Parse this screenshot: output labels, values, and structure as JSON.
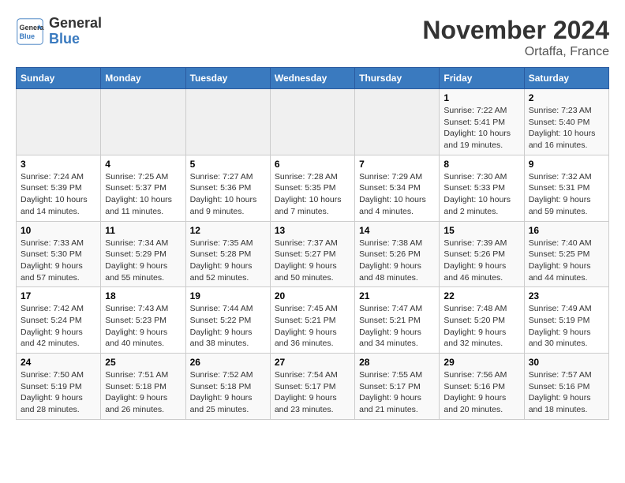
{
  "logo": {
    "line1": "General",
    "line2": "Blue"
  },
  "title": "November 2024",
  "location": "Ortaffa, France",
  "weekdays": [
    "Sunday",
    "Monday",
    "Tuesday",
    "Wednesday",
    "Thursday",
    "Friday",
    "Saturday"
  ],
  "weeks": [
    [
      {
        "day": "",
        "info": ""
      },
      {
        "day": "",
        "info": ""
      },
      {
        "day": "",
        "info": ""
      },
      {
        "day": "",
        "info": ""
      },
      {
        "day": "",
        "info": ""
      },
      {
        "day": "1",
        "info": "Sunrise: 7:22 AM\nSunset: 5:41 PM\nDaylight: 10 hours and 19 minutes."
      },
      {
        "day": "2",
        "info": "Sunrise: 7:23 AM\nSunset: 5:40 PM\nDaylight: 10 hours and 16 minutes."
      }
    ],
    [
      {
        "day": "3",
        "info": "Sunrise: 7:24 AM\nSunset: 5:39 PM\nDaylight: 10 hours and 14 minutes."
      },
      {
        "day": "4",
        "info": "Sunrise: 7:25 AM\nSunset: 5:37 PM\nDaylight: 10 hours and 11 minutes."
      },
      {
        "day": "5",
        "info": "Sunrise: 7:27 AM\nSunset: 5:36 PM\nDaylight: 10 hours and 9 minutes."
      },
      {
        "day": "6",
        "info": "Sunrise: 7:28 AM\nSunset: 5:35 PM\nDaylight: 10 hours and 7 minutes."
      },
      {
        "day": "7",
        "info": "Sunrise: 7:29 AM\nSunset: 5:34 PM\nDaylight: 10 hours and 4 minutes."
      },
      {
        "day": "8",
        "info": "Sunrise: 7:30 AM\nSunset: 5:33 PM\nDaylight: 10 hours and 2 minutes."
      },
      {
        "day": "9",
        "info": "Sunrise: 7:32 AM\nSunset: 5:31 PM\nDaylight: 9 hours and 59 minutes."
      }
    ],
    [
      {
        "day": "10",
        "info": "Sunrise: 7:33 AM\nSunset: 5:30 PM\nDaylight: 9 hours and 57 minutes."
      },
      {
        "day": "11",
        "info": "Sunrise: 7:34 AM\nSunset: 5:29 PM\nDaylight: 9 hours and 55 minutes."
      },
      {
        "day": "12",
        "info": "Sunrise: 7:35 AM\nSunset: 5:28 PM\nDaylight: 9 hours and 52 minutes."
      },
      {
        "day": "13",
        "info": "Sunrise: 7:37 AM\nSunset: 5:27 PM\nDaylight: 9 hours and 50 minutes."
      },
      {
        "day": "14",
        "info": "Sunrise: 7:38 AM\nSunset: 5:26 PM\nDaylight: 9 hours and 48 minutes."
      },
      {
        "day": "15",
        "info": "Sunrise: 7:39 AM\nSunset: 5:26 PM\nDaylight: 9 hours and 46 minutes."
      },
      {
        "day": "16",
        "info": "Sunrise: 7:40 AM\nSunset: 5:25 PM\nDaylight: 9 hours and 44 minutes."
      }
    ],
    [
      {
        "day": "17",
        "info": "Sunrise: 7:42 AM\nSunset: 5:24 PM\nDaylight: 9 hours and 42 minutes."
      },
      {
        "day": "18",
        "info": "Sunrise: 7:43 AM\nSunset: 5:23 PM\nDaylight: 9 hours and 40 minutes."
      },
      {
        "day": "19",
        "info": "Sunrise: 7:44 AM\nSunset: 5:22 PM\nDaylight: 9 hours and 38 minutes."
      },
      {
        "day": "20",
        "info": "Sunrise: 7:45 AM\nSunset: 5:21 PM\nDaylight: 9 hours and 36 minutes."
      },
      {
        "day": "21",
        "info": "Sunrise: 7:47 AM\nSunset: 5:21 PM\nDaylight: 9 hours and 34 minutes."
      },
      {
        "day": "22",
        "info": "Sunrise: 7:48 AM\nSunset: 5:20 PM\nDaylight: 9 hours and 32 minutes."
      },
      {
        "day": "23",
        "info": "Sunrise: 7:49 AM\nSunset: 5:19 PM\nDaylight: 9 hours and 30 minutes."
      }
    ],
    [
      {
        "day": "24",
        "info": "Sunrise: 7:50 AM\nSunset: 5:19 PM\nDaylight: 9 hours and 28 minutes."
      },
      {
        "day": "25",
        "info": "Sunrise: 7:51 AM\nSunset: 5:18 PM\nDaylight: 9 hours and 26 minutes."
      },
      {
        "day": "26",
        "info": "Sunrise: 7:52 AM\nSunset: 5:18 PM\nDaylight: 9 hours and 25 minutes."
      },
      {
        "day": "27",
        "info": "Sunrise: 7:54 AM\nSunset: 5:17 PM\nDaylight: 9 hours and 23 minutes."
      },
      {
        "day": "28",
        "info": "Sunrise: 7:55 AM\nSunset: 5:17 PM\nDaylight: 9 hours and 21 minutes."
      },
      {
        "day": "29",
        "info": "Sunrise: 7:56 AM\nSunset: 5:16 PM\nDaylight: 9 hours and 20 minutes."
      },
      {
        "day": "30",
        "info": "Sunrise: 7:57 AM\nSunset: 5:16 PM\nDaylight: 9 hours and 18 minutes."
      }
    ]
  ]
}
